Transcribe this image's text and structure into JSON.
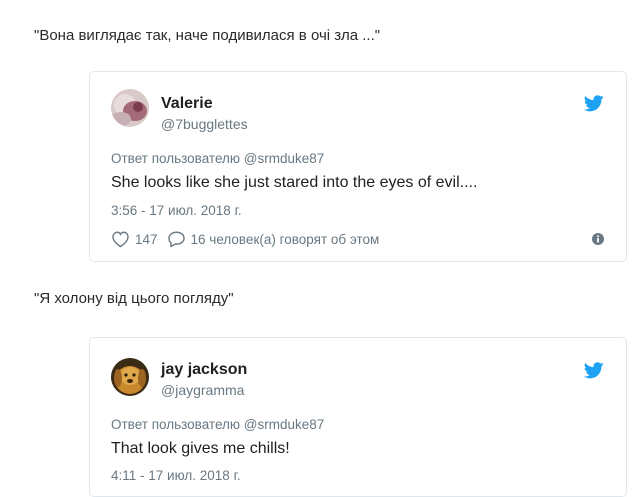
{
  "captions": [
    "\"Вона виглядає так, наче подивилася в очі зла ...\"",
    "\"Я холону від цього погляду\""
  ],
  "tweets": [
    {
      "name": "Valerie",
      "handle": "@7bugglettes",
      "reply_to": "Ответ пользователю @srmduke87",
      "text": "She looks like she just stared into the eyes of evil....",
      "timestamp": "3:56 - 17 июл. 2018 г.",
      "likes": "147",
      "replies": "16 человек(а) говорят об этом"
    },
    {
      "name": "jay jackson",
      "handle": "@jaygramma",
      "reply_to": "Ответ пользователю @srmduke87",
      "text": "That look gives me chills!",
      "timestamp": "4:11 - 17 июл. 2018 г."
    }
  ],
  "colors": {
    "twitter_blue": "#1da1f2",
    "muted_text": "#697882",
    "border": "#e1e8ed"
  },
  "icons": {
    "bird": "twitter-bird-icon",
    "like": "heart-icon",
    "reply": "speech-bubble-icon",
    "info": "info-icon"
  }
}
